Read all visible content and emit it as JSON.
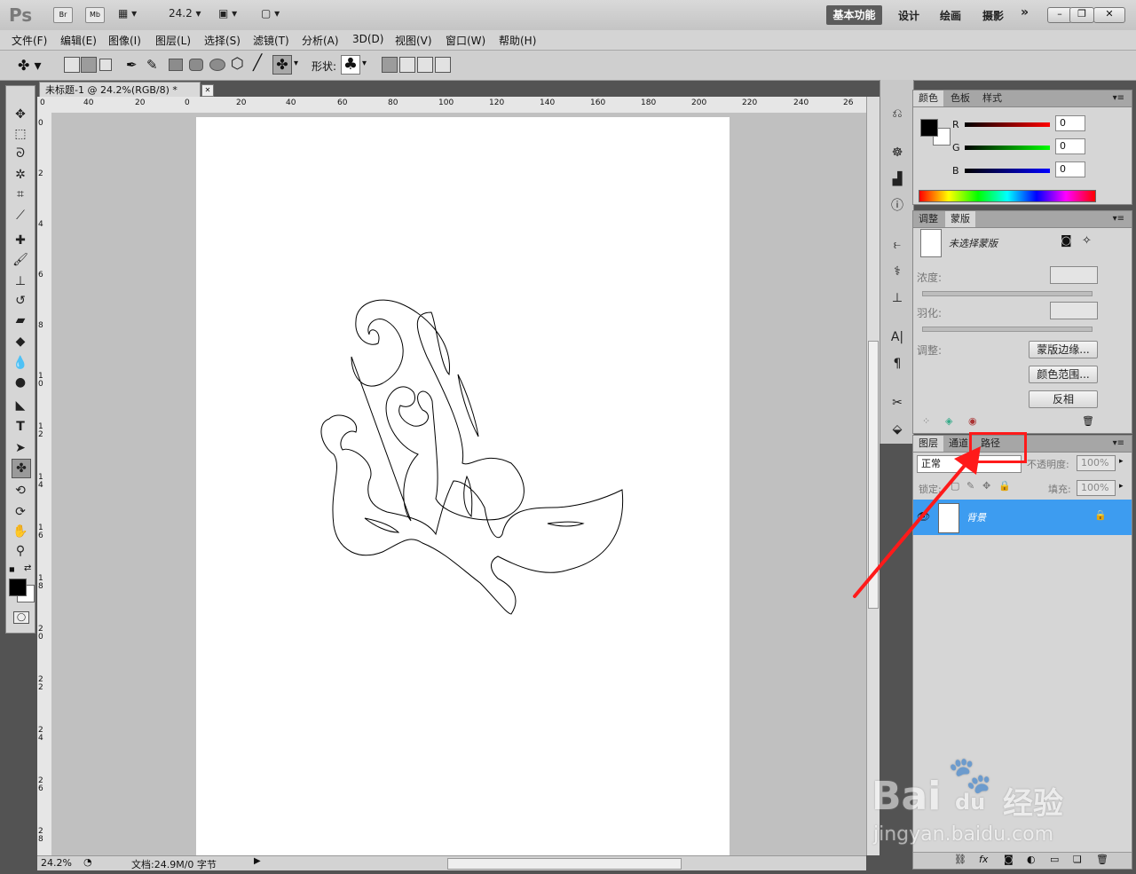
{
  "titlebar": {
    "app_logo": "Ps",
    "bridge_btn": "Br",
    "minibridge_btn": "Mb",
    "zoom_value": "24.2",
    "workspaces": {
      "active": "基本功能",
      "tab2": "设计",
      "tab3": "绘画",
      "tab4": "摄影",
      "more": "»"
    }
  },
  "menubar": {
    "items": [
      "文件(F)",
      "编辑(E)",
      "图像(I)",
      "图层(L)",
      "选择(S)",
      "滤镜(T)",
      "分析(A)",
      "3D(D)",
      "视图(V)",
      "窗口(W)",
      "帮助(H)"
    ]
  },
  "options": {
    "shape_label": "形状:"
  },
  "document": {
    "tab_title": "未标题-1 @ 24.2%(RGB/8) *",
    "ruler_top_labels": [
      "0",
      "40",
      "20",
      "0",
      "20",
      "40",
      "60",
      "80",
      "100",
      "120",
      "140",
      "160",
      "180",
      "200",
      "220",
      "240",
      "26"
    ],
    "ruler_left_labels": [
      "0",
      "2",
      "4",
      "6",
      "8",
      "1 0",
      "1 2",
      "1 4",
      "1 6",
      "1 8",
      "2 0",
      "2 2",
      "2 4",
      "2 6",
      "2 8"
    ],
    "status_zoom": "24.2%",
    "status_doc": "文档:24.9M/0 字节"
  },
  "color_panel": {
    "tabs": [
      "颜色",
      "色板",
      "样式"
    ],
    "r_label": "R",
    "g_label": "G",
    "b_label": "B",
    "r_value": "0",
    "g_value": "0",
    "b_value": "0"
  },
  "mask_panel": {
    "tabs": [
      "调整",
      "蒙版"
    ],
    "mask_status": "未选择蒙版",
    "density_label": "浓度:",
    "feather_label": "羽化:",
    "refine_label": "调整:",
    "btn_mask_edge": "蒙版边缘...",
    "btn_color_range": "颜色范围...",
    "btn_invert": "反相"
  },
  "layers_panel": {
    "tabs": [
      "图层",
      "通道",
      "路径"
    ],
    "blend_mode": "正常",
    "opacity_label": "不透明度:",
    "opacity_value": "100%",
    "lock_label": "锁定:",
    "fill_label": "填充:",
    "fill_value": "100%",
    "layer_name": "背景"
  },
  "watermark": {
    "brand": "Bai",
    "brand2": "du",
    "brand_cn": "经验",
    "url": "jingyan.baidu.com"
  },
  "colors": {
    "accent_selection": "#3d9cf0",
    "annotation_red": "#ff1a1a"
  }
}
